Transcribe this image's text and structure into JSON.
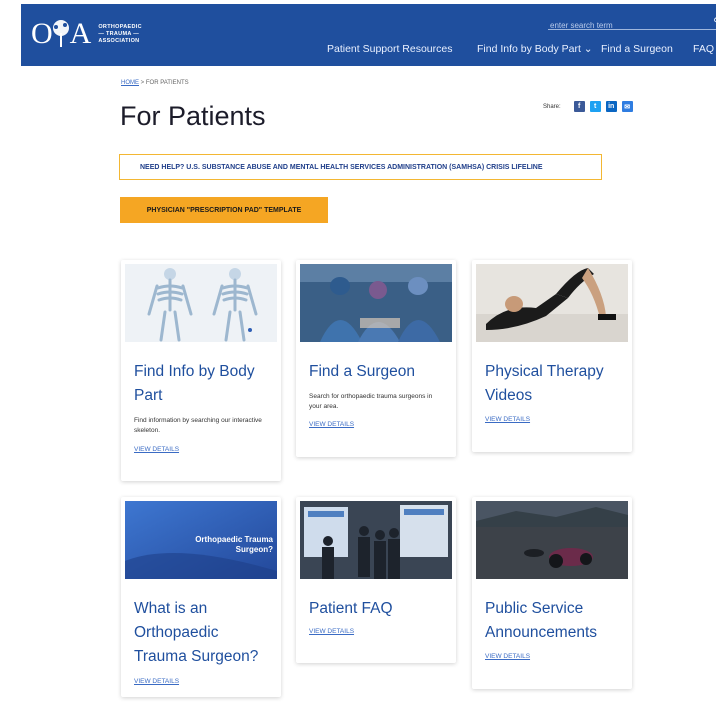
{
  "header": {
    "logo_letters": "OTA",
    "logo_text": [
      "ORTHOPAEDIC",
      "— TRAUMA —",
      "ASSOCIATION"
    ],
    "search_placeholder": "enter search term",
    "nav": [
      "Patient Support Resources",
      "Find Info by Body Part ⌄",
      "Find a Surgeon",
      "FAQ"
    ]
  },
  "breadcrumb": {
    "home": "HOME",
    "sep": ">",
    "current": "FOR PATIENTS"
  },
  "page_title": "For Patients",
  "share": {
    "label": "Share:",
    "icons": [
      "f",
      "t",
      "in",
      "✉"
    ]
  },
  "banner": "NEED HELP? U.S. SUBSTANCE ABUSE AND MENTAL HEALTH SERVICES ADMINISTRATION (SAMHSA) CRISIS LIFELINE",
  "cta": "PHYSICIAN \"PRESCRIPTION PAD\" TEMPLATE",
  "cards": [
    {
      "title": "Find Info by Body Part",
      "desc": "Find information by searching our interactive skeleton.",
      "link": "VIEW DETAILS"
    },
    {
      "title": "Find a Surgeon",
      "desc": "Search for orthopaedic trauma surgeons in your area.",
      "link": "VIEW DETAILS"
    },
    {
      "title": "Physical Therapy Videos",
      "desc": "",
      "link": "VIEW DETAILS"
    },
    {
      "title": "What is an Orthopaedic Trauma Surgeon?",
      "desc": "",
      "link": "VIEW DETAILS",
      "image_text": "Orthopaedic Trauma Surgeon?"
    },
    {
      "title": "Patient FAQ",
      "desc": "",
      "link": "VIEW DETAILS"
    },
    {
      "title": "Public Service Announcements",
      "desc": "",
      "link": "VIEW DETAILS"
    }
  ],
  "colors": {
    "brand": "#1f4f9e",
    "accent": "#f5a623",
    "banner_border": "#f3b733",
    "link": "#3a6bc4"
  }
}
